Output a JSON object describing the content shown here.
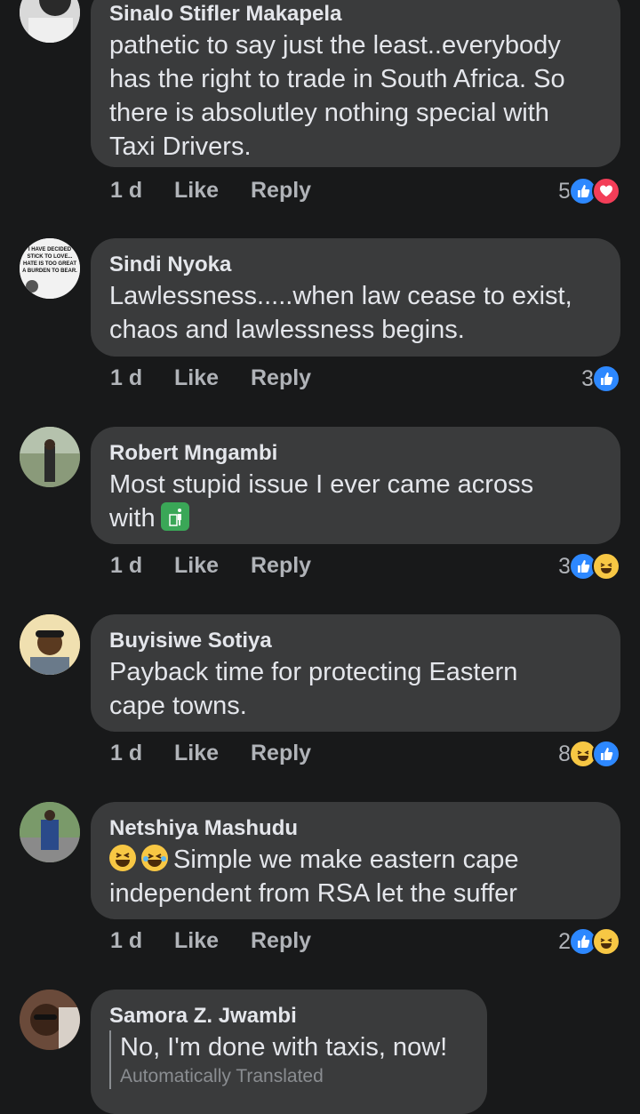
{
  "comments": [
    {
      "name": "Sinalo Stifler Makapela",
      "lines": [
        "pathetic to say just the least..everybody",
        "has the right to trade in South Africa. So",
        "there is absolutley nothing special with",
        "Taxi Drivers."
      ],
      "time": "1 d",
      "like": "Like",
      "reply": "Reply",
      "react_count": "5",
      "reactions": [
        "like-icon",
        "love-icon"
      ]
    },
    {
      "name": "Sindi Nyoka",
      "lines": [
        "Lawlessness.....when law cease to exist,",
        "chaos and lawlessness begins."
      ],
      "time": "1 d",
      "like": "Like",
      "reply": "Reply",
      "react_count": "3",
      "reactions": [
        "like-icon"
      ]
    },
    {
      "name": "Robert Mngambi",
      "lines": [
        "Most stupid issue I ever came across",
        "with"
      ],
      "time": "1 d",
      "like": "Like",
      "reply": "Reply",
      "react_count": "3",
      "reactions": [
        "like-icon",
        "haha-icon"
      ]
    },
    {
      "name": "Buyisiwe Sotiya",
      "lines": [
        "Payback time for protecting Eastern",
        "cape towns."
      ],
      "time": "1 d",
      "like": "Like",
      "reply": "Reply",
      "react_count": "8",
      "reactions": [
        "haha-icon",
        "like-icon"
      ]
    },
    {
      "name": "Netshiya Mashudu",
      "lines": [
        "Simple we make eastern cape",
        "independent from RSA let the suffer"
      ],
      "time": "1 d",
      "like": "Like",
      "reply": "Reply",
      "react_count": "2",
      "reactions": [
        "like-icon",
        "haha-icon"
      ]
    },
    {
      "name": "Samora Z. Jwambi",
      "lines": [
        "No, I'm done with taxis, now!"
      ],
      "translated_label": "Automatically Translated"
    }
  ],
  "avatar2_text": [
    "I HAVE DECIDED",
    "STICK TO LOVE...",
    "HATE IS TOO GREAT",
    "A BURDEN TO BEAR."
  ],
  "colors": {
    "background": "#18191a",
    "bubble": "#3a3b3c",
    "like": "#2d88ff",
    "love": "#f33e58",
    "haha": "#f7c744"
  }
}
